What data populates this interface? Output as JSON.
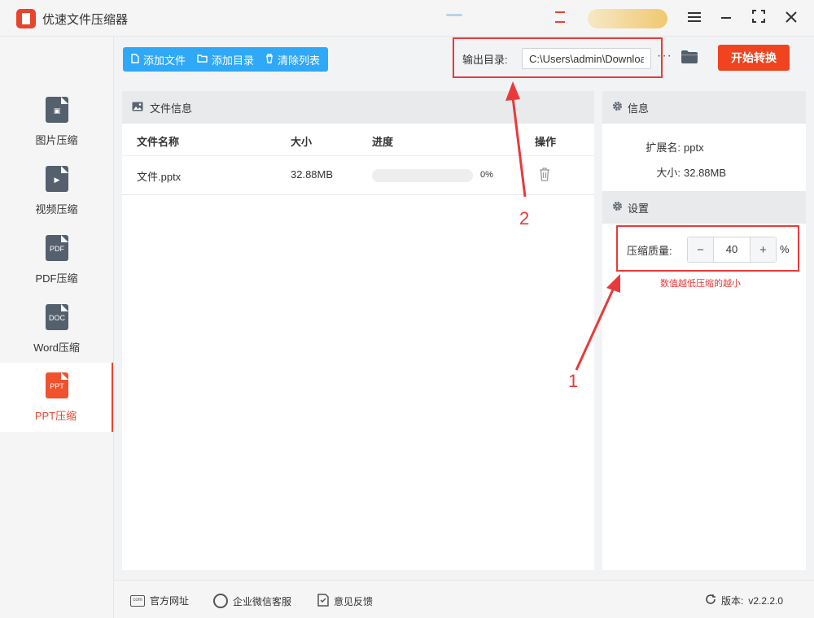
{
  "app": {
    "title": "优速文件压缩器"
  },
  "window_controls": {
    "menu_icon": "menu-icon",
    "minimize_icon": "minimize-icon",
    "maximize_icon": "maximize-icon",
    "close_icon": "close-icon"
  },
  "sidebar": {
    "items": [
      {
        "label": "图片压缩",
        "icon": "image-file-icon",
        "glyph": "▣",
        "active": false
      },
      {
        "label": "视频压缩",
        "icon": "video-file-icon",
        "glyph": "▶",
        "active": false
      },
      {
        "label": "PDF压缩",
        "icon": "pdf-file-icon",
        "glyph": "PDF",
        "active": false
      },
      {
        "label": "Word压缩",
        "icon": "doc-file-icon",
        "glyph": "DOC",
        "active": false
      },
      {
        "label": "PPT压缩",
        "icon": "ppt-file-icon",
        "glyph": "PPT",
        "active": true
      }
    ]
  },
  "toolbar": {
    "add_file": "添加文件",
    "add_folder": "添加目录",
    "clear_list": "清除列表",
    "output_label": "输出目录:",
    "output_path": "C:\\Users\\admin\\Downloads",
    "more": "···",
    "start": "开始转换"
  },
  "file_panel": {
    "title": "文件信息",
    "columns": [
      "文件名称",
      "大小",
      "进度",
      "操作"
    ],
    "rows": [
      {
        "name": "文件.pptx",
        "size": "32.88MB",
        "progress": 0,
        "progress_text": "0%"
      }
    ]
  },
  "info_panel": {
    "title": "信息",
    "ext_label": "扩展名:",
    "ext_value": "pptx",
    "size_label": "大小:",
    "size_value": "32.88MB"
  },
  "settings_panel": {
    "title": "设置",
    "quality_label": "压缩质量:",
    "quality_value": "40",
    "minus": "−",
    "plus": "+",
    "unit": "%",
    "hint": "数值越低压缩的越小"
  },
  "annotations": {
    "label_1": "1",
    "label_2": "2",
    "color": "#e83a3a"
  },
  "footer": {
    "website": "官方网址",
    "wechat": "企业微信客服",
    "feedback": "意见反馈",
    "version_label": "版本:",
    "version": "v2.2.2.0"
  },
  "colors": {
    "accent_blue": "#2fa8f8",
    "accent_red": "#f0431f",
    "active_nav": "#e8432c"
  }
}
